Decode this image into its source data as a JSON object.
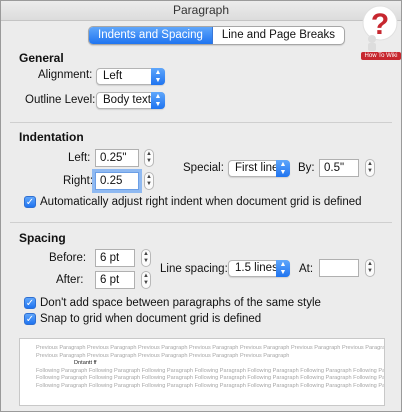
{
  "window": {
    "title": "Paragraph"
  },
  "tabs": [
    {
      "label": "Indents and Spacing",
      "active": true
    },
    {
      "label": "Line and Page Breaks",
      "active": false
    }
  ],
  "general": {
    "heading": "General",
    "alignment_label": "Alignment:",
    "alignment_value": "Left",
    "outline_label": "Outline Level:",
    "outline_value": "Body text"
  },
  "indentation": {
    "heading": "Indentation",
    "left_label": "Left:",
    "left_value": "0.25\"",
    "right_label": "Right:",
    "right_value": "0.25",
    "special_label": "Special:",
    "special_value": "First line",
    "by_label": "By:",
    "by_value": "0.5\"",
    "auto_adjust_label": "Automatically adjust right indent when document grid is defined",
    "auto_adjust_checked": true
  },
  "spacing": {
    "heading": "Spacing",
    "before_label": "Before:",
    "before_value": "6 pt",
    "after_label": "After:",
    "after_value": "6 pt",
    "line_spacing_label": "Line spacing:",
    "line_spacing_value": "1.5 lines",
    "at_label": "At:",
    "at_value": "",
    "no_space_label": "Don't add space between paragraphs of the same style",
    "no_space_checked": true,
    "snap_label": "Snap to grid when document grid is defined",
    "snap_checked": true
  },
  "preview": {
    "previous_1": "Previous Paragraph Previous Paragraph Previous Paragraph Previous Paragraph Previous Paragraph Previous Paragraph Previous Paragraph",
    "previous_2": "Previous Paragraph Previous Paragraph Previous Paragraph Previous Paragraph Previous Paragraph",
    "sample": "Dntantt ff",
    "following_1": "Following Paragraph Following Paragraph Following Paragraph Following Paragraph Following Paragraph Following Paragraph Following Paragraph",
    "following_2": "Following Paragraph Following Paragraph Following Paragraph Following Paragraph Following Paragraph Following Paragraph Following Paragraph",
    "following_3": "Following Paragraph Following Paragraph Following Paragraph Following Paragraph Following Paragraph Following Paragraph Following Paragraph"
  },
  "watermark": {
    "text": "How To Wiki",
    "color": "#c7272f"
  },
  "colors": {
    "accent": "#1f74f0",
    "focus_ring": "#8fb9f1"
  }
}
